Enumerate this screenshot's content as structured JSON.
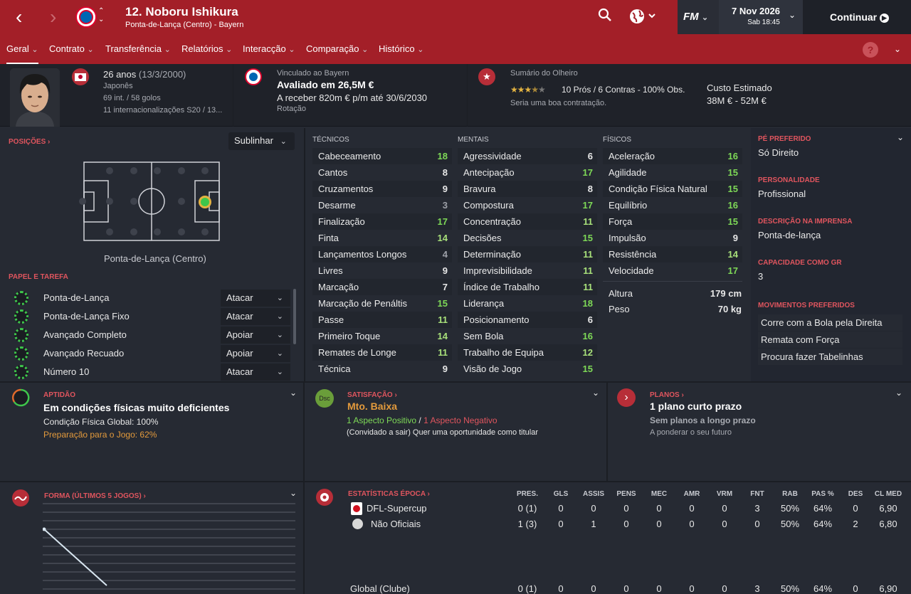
{
  "header": {
    "player_name": "12. Noboru Ishikura",
    "player_sub": "Ponta-de-Lança (Centro) - Bayern",
    "date": "7 Nov 2026",
    "date_sub": "Sab 18:45",
    "continue_label": "Continuar",
    "fm_label": "FM"
  },
  "tabs": [
    "Geral",
    "Contrato",
    "Transferência",
    "Relatórios",
    "Interacção",
    "Comparação",
    "Histórico"
  ],
  "profile": {
    "age": "26 anos",
    "dob": "(13/3/2000)",
    "nationality": "Japonês",
    "caps": "69 int. / 58 golos",
    "youth_caps": "11 internacionalizações S20 / 13..."
  },
  "contract": {
    "label": "Vinculado ao Bayern",
    "value": "Avaliado em 26,5M €",
    "wage": "A receber 820m € p/m até 30/6/2030",
    "status": "Rotação"
  },
  "scout": {
    "label": "Sumário do Olheiro",
    "summary": "10 Prós / 6 Contras - 100% Obs.",
    "verdict": "Seria uma boa contratação.",
    "cost_label": "Custo Estimado",
    "cost_value": "38M € - 52M €",
    "stars": 3.5
  },
  "positions": {
    "title": "POSIÇÕES",
    "dropdown": "Sublinhar",
    "position_label": "Ponta-de-Lança (Centro)"
  },
  "roles": {
    "title": "PAPEL E TAREFA",
    "items": [
      {
        "name": "Ponta-de-Lança",
        "duty": "Atacar"
      },
      {
        "name": "Ponta-de-Lança Fixo",
        "duty": "Atacar"
      },
      {
        "name": "Avançado Completo",
        "duty": "Apoiar"
      },
      {
        "name": "Avançado Recuado",
        "duty": "Apoiar"
      },
      {
        "name": "Número 10",
        "duty": "Atacar"
      }
    ]
  },
  "technical": {
    "title": "TÉCNICOS",
    "items": [
      [
        "Cabeceamento",
        "18"
      ],
      [
        "Cantos",
        "8"
      ],
      [
        "Cruzamentos",
        "9"
      ],
      [
        "Desarme",
        "3"
      ],
      [
        "Finalização",
        "17"
      ],
      [
        "Finta",
        "14"
      ],
      [
        "Lançamentos Longos",
        "4"
      ],
      [
        "Livres",
        "9"
      ],
      [
        "Marcação",
        "7"
      ],
      [
        "Marcação de Penáltis",
        "15"
      ],
      [
        "Passe",
        "11"
      ],
      [
        "Primeiro Toque",
        "14"
      ],
      [
        "Remates de Longe",
        "11"
      ],
      [
        "Técnica",
        "9"
      ]
    ]
  },
  "mental": {
    "title": "MENTAIS",
    "items": [
      [
        "Agressividade",
        "6"
      ],
      [
        "Antecipação",
        "17"
      ],
      [
        "Bravura",
        "8"
      ],
      [
        "Compostura",
        "17"
      ],
      [
        "Concentração",
        "11"
      ],
      [
        "Decisões",
        "15"
      ],
      [
        "Determinação",
        "11"
      ],
      [
        "Imprevisibilidade",
        "11"
      ],
      [
        "Índice de Trabalho",
        "11"
      ],
      [
        "Liderança",
        "18"
      ],
      [
        "Posicionamento",
        "6"
      ],
      [
        "Sem Bola",
        "16"
      ],
      [
        "Trabalho de Equipa",
        "12"
      ],
      [
        "Visão de Jogo",
        "15"
      ]
    ]
  },
  "physical": {
    "title": "FÍSICOS",
    "items": [
      [
        "Aceleração",
        "16"
      ],
      [
        "Agilidade",
        "15"
      ],
      [
        "Condição Física Natural",
        "15"
      ],
      [
        "Equilíbrio",
        "16"
      ],
      [
        "Força",
        "15"
      ],
      [
        "Impulsão",
        "9"
      ],
      [
        "Resistência",
        "14"
      ],
      [
        "Velocidade",
        "17"
      ]
    ],
    "height_label": "Altura",
    "height": "179 cm",
    "weight_label": "Peso",
    "weight": "70 kg"
  },
  "info": {
    "foot_label": "PÉ PREFERIDO",
    "foot": "Só Direito",
    "pers_label": "PERSONALIDADE",
    "pers": "Profissional",
    "press_label": "DESCRIÇÃO NA IMPRENSA",
    "press": "Ponta-de-lança",
    "gk_label": "CAPACIDADE COMO GR",
    "gk": "3",
    "moves_label": "MOVIMENTOS PREFERIDOS",
    "moves": [
      "Corre com a Bola pela Direita",
      "Remata com Força",
      "Procura fazer Tabelinhas"
    ]
  },
  "fitness": {
    "title": "APTIDÃO",
    "headline": "Em condições físicas muito deficientes",
    "line1": "Condição Física Global: 100%",
    "line2": "Preparação para o Jogo: 62%"
  },
  "happiness": {
    "title": "SATISFAÇÃO",
    "badge": "Dsc",
    "headline": "Mto. Baixa",
    "pos": "1 Aspecto Positivo",
    "sep": "/",
    "neg": "1 Aspecto Negativo",
    "detail": "(Convidado a sair) Quer uma oportunidade como titular"
  },
  "plans": {
    "title": "PLANOS",
    "headline": "1 plano curto prazo",
    "line1": "Sem planos a longo prazo",
    "line2": "A ponderar o seu futuro"
  },
  "form": {
    "title": "FORMA (ÚLTIMOS 5 JOGOS)"
  },
  "season": {
    "title": "ESTATÍSTICAS ÉPOCA",
    "headers": [
      "PRES.",
      "GLS",
      "ASSIS",
      "PENS",
      "MEC",
      "AMR",
      "VRM",
      "FNT",
      "RAB",
      "PAS %",
      "DES",
      "CL MED"
    ],
    "rows": [
      {
        "name": "DFL-Supercup",
        "vals": [
          "0 (1)",
          "0",
          "0",
          "0",
          "0",
          "0",
          "0",
          "3",
          "50%",
          "64%",
          "0",
          "6,90"
        ]
      },
      {
        "name": "Não Oficiais",
        "vals": [
          "1 (3)",
          "0",
          "1",
          "0",
          "0",
          "0",
          "0",
          "0",
          "50%",
          "64%",
          "2",
          "6,80"
        ]
      }
    ],
    "total": {
      "name": "Global (Clube)",
      "vals": [
        "0 (1)",
        "0",
        "0",
        "0",
        "0",
        "0",
        "0",
        "3",
        "50%",
        "64%",
        "0",
        "6,90"
      ]
    }
  },
  "colors": {
    "accent": "#a31f28",
    "good": "#7ed957",
    "mid": "#c6c6c6",
    "section": "#e0555e"
  }
}
